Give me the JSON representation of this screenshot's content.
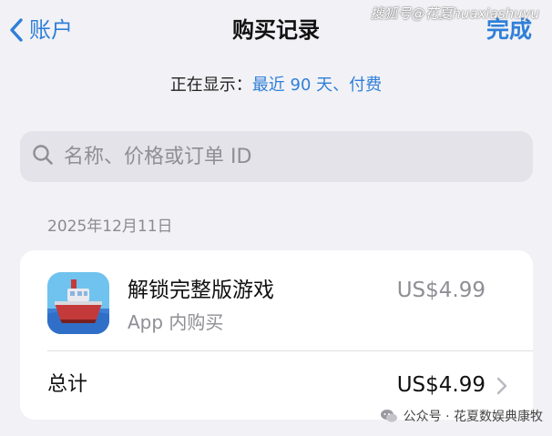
{
  "nav": {
    "back_label": "账户",
    "title": "购买记录",
    "done_label": "完成"
  },
  "watermark_top": "搜狐号@花夏huaxiashuyu",
  "filter": {
    "label": "正在显示：",
    "value": "最近 90 天、付费"
  },
  "search": {
    "placeholder": "名称、价格或订单 ID"
  },
  "purchase_date": "2025年12月11日",
  "purchase": {
    "title": "解锁完整版游戏",
    "subtitle": "App 内购买",
    "price": "US$4.99",
    "icon": "boat-game-app-icon"
  },
  "total": {
    "label": "总计",
    "value": "US$4.99"
  },
  "watermark_bottom": "公众号 · 花夏数娱典康牧",
  "colors": {
    "accent": "#2f7fd8",
    "background": "#f2f2f6",
    "card": "#ffffff",
    "secondary_text": "#8e8e94"
  }
}
